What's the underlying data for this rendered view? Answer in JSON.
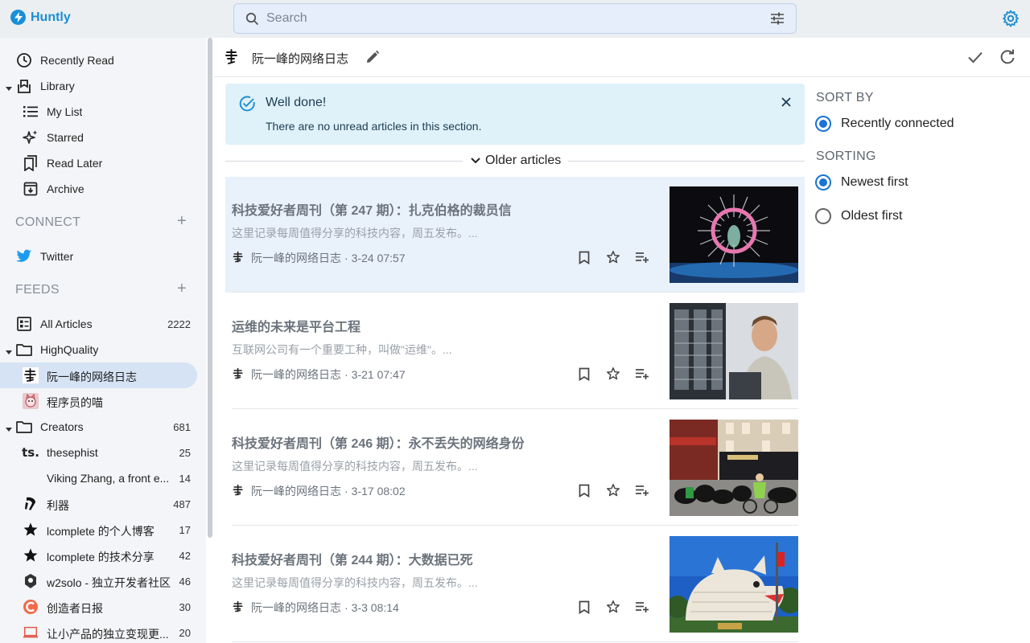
{
  "app": {
    "name": "Huntly"
  },
  "search": {
    "placeholder": "Search"
  },
  "sidebar": {
    "top_items": [
      {
        "label": "Recently Read",
        "icon": "clock-icon"
      },
      {
        "label": "Library",
        "icon": "library-icon"
      },
      {
        "label": "My List",
        "icon": "list-icon"
      },
      {
        "label": "Starred",
        "icon": "sparkle-icon"
      },
      {
        "label": "Read Later",
        "icon": "bookmarks-icon"
      },
      {
        "label": "Archive",
        "icon": "archive-icon"
      }
    ],
    "connect": {
      "title": "CONNECT",
      "items": [
        {
          "label": "Twitter",
          "icon": "twitter-icon"
        }
      ]
    },
    "feeds": {
      "title": "FEEDS",
      "all_articles": {
        "label": "All Articles",
        "count": "2222"
      },
      "folders": [
        {
          "label": "HighQuality",
          "children": [
            {
              "label": "阮一峰的网络日志"
            },
            {
              "label": "程序员的喵"
            }
          ]
        },
        {
          "label": "Creators",
          "count": "681",
          "children": [
            {
              "label": "thesephist",
              "count": "25"
            },
            {
              "label": "Viking Zhang, a front e...",
              "count": "14"
            },
            {
              "label": "利器",
              "count": "487"
            },
            {
              "label": "lcomplete 的个人博客",
              "count": "17"
            },
            {
              "label": "lcomplete 的技术分享",
              "count": "42"
            },
            {
              "label": "w2solo - 独立开发者社区",
              "count": "46"
            },
            {
              "label": "创造者日报",
              "count": "30"
            },
            {
              "label": "让小产品的独立变现更...",
              "count": "20"
            }
          ]
        }
      ]
    }
  },
  "header": {
    "title": "阮一峰的网络日志"
  },
  "notice": {
    "title": "Well done!",
    "text": "There are no unread articles in this section."
  },
  "older_label": "Older articles",
  "articles": [
    {
      "title": "科技爱好者周刊（第 247 期）：扎克伯格的裁员信",
      "summary": "这里记录每周值得分享的科技内容，周五发布。...",
      "source": "阮一峰的网络日志",
      "date": "3-24 07:57"
    },
    {
      "title": "运维的未来是平台工程",
      "summary": "互联网公司有一个重要工种，叫做\"运维\"。...",
      "source": "阮一峰的网络日志",
      "date": "3-21 07:47"
    },
    {
      "title": "科技爱好者周刊（第 246 期）：永不丢失的网络身份",
      "summary": "这里记录每周值得分享的科技内容，周五发布。...",
      "source": "阮一峰的网络日志",
      "date": "3-17 08:02"
    },
    {
      "title": "科技爱好者周刊（第 244 期）：大数据已死",
      "summary": "这里记录每周值得分享的科技内容，周五发布。...",
      "source": "阮一峰的网络日志",
      "date": "3-3 08:14"
    }
  ],
  "sort_panel": {
    "sort_by_title": "SORT BY",
    "sort_by_options": [
      {
        "label": "Recently connected",
        "selected": true
      }
    ],
    "sorting_title": "SORTING",
    "sorting_options": [
      {
        "label": "Newest first",
        "selected": true
      },
      {
        "label": "Oldest first",
        "selected": false
      }
    ]
  },
  "colors": {
    "accent": "#1a8ed6",
    "active_bg": "#d5e3f5",
    "notice_bg": "#dff1f9"
  }
}
